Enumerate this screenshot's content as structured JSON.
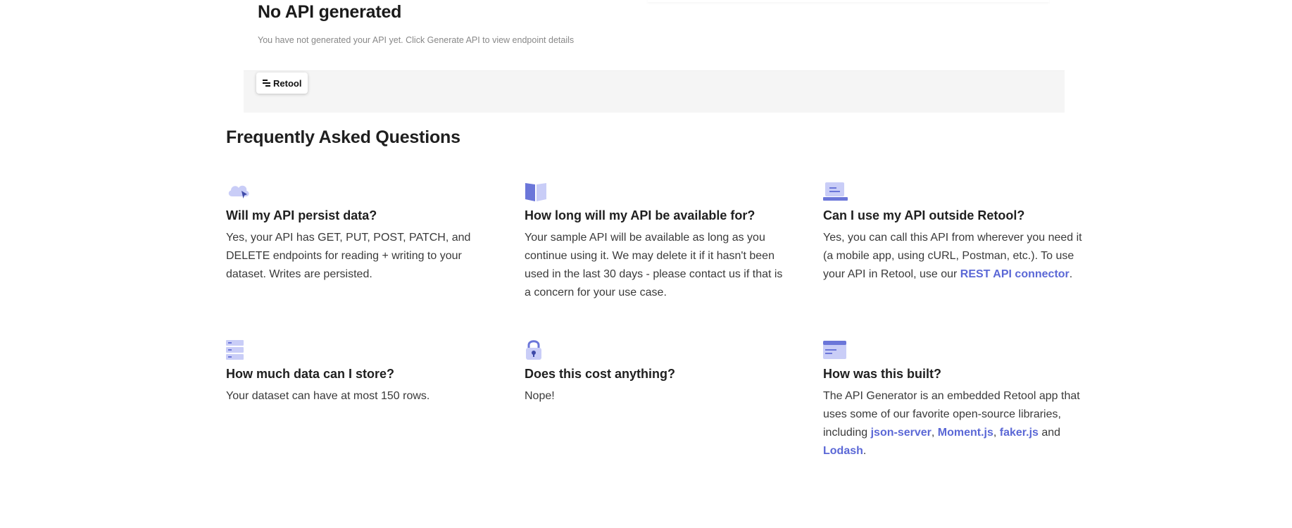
{
  "api_status": {
    "title": "No API generated",
    "subtitle": "You have not generated your API yet. Click Generate API to view endpoint details"
  },
  "retool_badge": {
    "label": "Retool",
    "icon": "retool-logo-icon"
  },
  "faq": {
    "heading": "Frequently Asked Questions",
    "items": [
      {
        "icon": "cloud-upload-icon",
        "question": "Will my API persist data?",
        "answer": "Yes, your API has GET, PUT, POST, PATCH, and DELETE endpoints for reading + writing to your dataset. Writes are persisted."
      },
      {
        "icon": "open-book-icon",
        "question": "How long will my API be available for?",
        "answer": "Your sample API will be available as long as you continue using it. We may delete it if it hasn't been used in the last 30 days - please contact us if that is a concern for your use case."
      },
      {
        "icon": "laptop-icon",
        "question": "Can I use my API outside Retool?",
        "answer_prefix": "Yes, you can call this API from wherever you need it (a mobile app, using cURL, Postman, etc.). To use your API in Retool, use our ",
        "link_rest": "REST API connector",
        "answer_suffix": "."
      },
      {
        "icon": "database-rows-icon",
        "question": "How much data can I store?",
        "answer": "Your dataset can have at most 150 rows."
      },
      {
        "icon": "padlock-icon",
        "question": "Does this cost anything?",
        "answer": "Nope!"
      },
      {
        "icon": "browser-window-icon",
        "question": "How was this built?",
        "answer_prefix": "The API Generator is an embedded Retool app that uses some of our favorite open-source libraries, including ",
        "link_json_server": "json-server",
        "sep1": ", ",
        "link_moment": "Moment.js",
        "sep2": ", ",
        "link_faker": "faker.js",
        "sep3": " and ",
        "link_lodash": "Lodash",
        "answer_suffix": "."
      }
    ]
  },
  "colors": {
    "icon_light": "#c9cdf7",
    "icon_dark": "#6b76d9",
    "link": "#5b68d6",
    "panel_bg": "#f5f5f5"
  }
}
